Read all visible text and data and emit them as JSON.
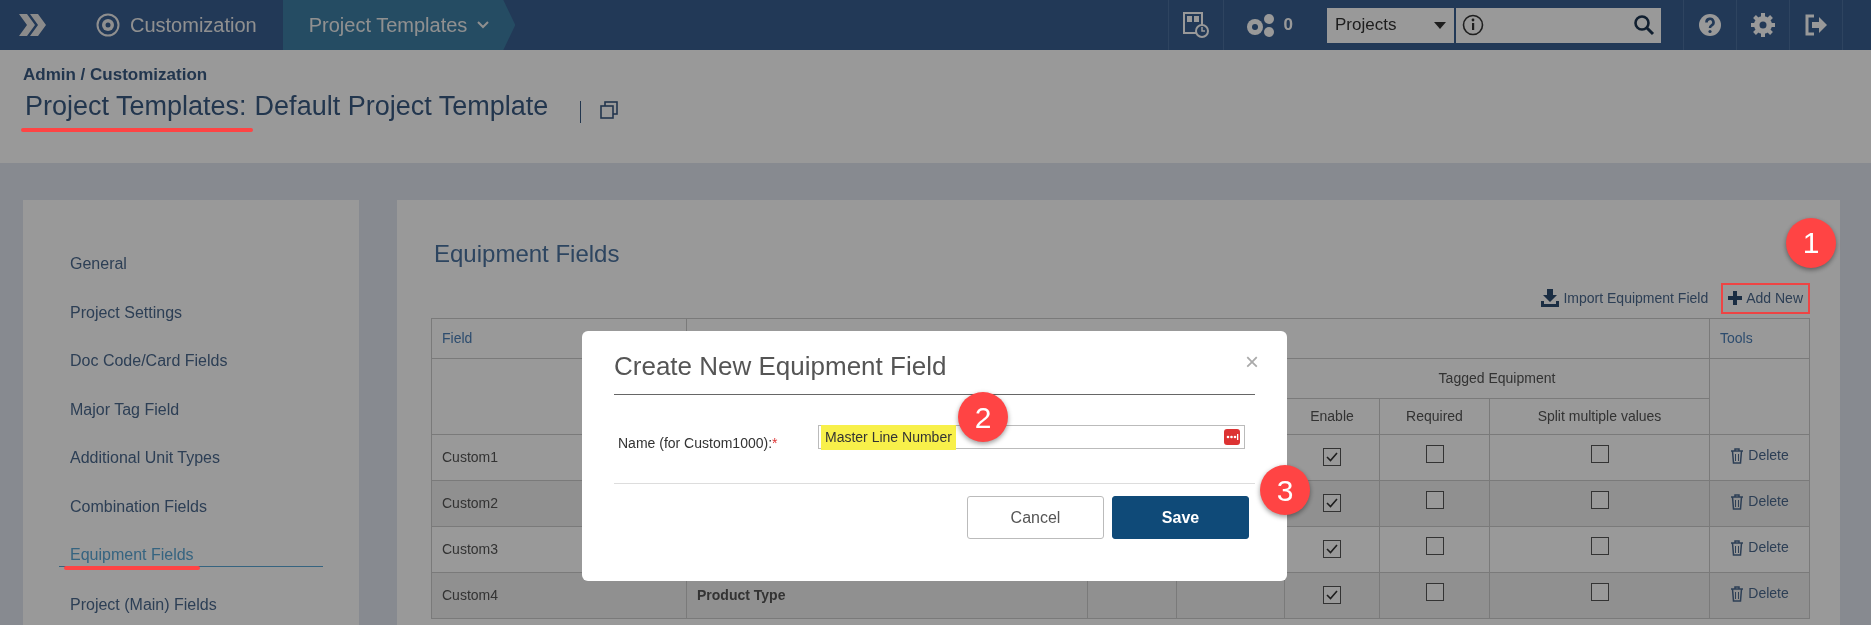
{
  "nav": {
    "breadcrumbs": [
      {
        "label": "Customization",
        "selected": false
      },
      {
        "label": "Project Templates",
        "selected": true
      }
    ],
    "jobs_count": "0",
    "scope_select": {
      "value": "Projects"
    }
  },
  "header": {
    "breadcrumb": "Admin / Customization",
    "title_parts": [
      {
        "text": "Project Templates:",
        "underlined": true
      },
      {
        "text": "Default Project Template",
        "underlined": false
      }
    ]
  },
  "sidebar": {
    "items": [
      {
        "label": "General",
        "selected": false,
        "annotated": false
      },
      {
        "label": "Project Settings",
        "selected": false,
        "annotated": false
      },
      {
        "label": "Doc Code/Card Fields",
        "selected": false,
        "annotated": false
      },
      {
        "label": "Major Tag Field",
        "selected": false,
        "annotated": false
      },
      {
        "label": "Additional Unit Types",
        "selected": false,
        "annotated": false
      },
      {
        "label": "Combination Fields",
        "selected": false,
        "annotated": false
      },
      {
        "label": "Equipment Fields",
        "selected": true,
        "annotated": true
      },
      {
        "label": "Project (Main) Fields",
        "selected": false,
        "annotated": false
      }
    ]
  },
  "content": {
    "title": "Equipment Fields",
    "actions": [
      {
        "label": "Import Equipment Field",
        "kind": "import",
        "annotated": false
      },
      {
        "label": "Add New",
        "kind": "add",
        "annotated": true
      }
    ],
    "table": {
      "header": {
        "field": "Field",
        "tools": "Tools",
        "group": "Tagged Equipment",
        "enable": "Enable",
        "required": "Required",
        "split": "Split multiple values"
      },
      "rows": [
        {
          "field": "Custom1",
          "enable": true,
          "required": false,
          "split": false,
          "tool": "Delete"
        },
        {
          "field": "Custom2",
          "enable": true,
          "required": false,
          "split": false,
          "tool": "Delete"
        },
        {
          "field": "Custom3",
          "enable": true,
          "required": false,
          "split": false,
          "tool": "Delete"
        },
        {
          "field": "Custom4",
          "column_2": "Product Type",
          "enable": true,
          "required": false,
          "split": false,
          "tool": "Delete"
        }
      ]
    }
  },
  "modal": {
    "title": "Create New Equipment Field",
    "close": "×",
    "label": "Name (for Custom1000):",
    "required_mark": "*",
    "value": "Master Line Number",
    "value_highlighted": true,
    "buttons": [
      {
        "label": "Cancel",
        "kind": "secondary"
      },
      {
        "label": "Save",
        "kind": "primary"
      }
    ]
  },
  "annotations": {
    "markers": [
      {
        "label": "1"
      },
      {
        "label": "2"
      },
      {
        "label": "3"
      }
    ]
  }
}
